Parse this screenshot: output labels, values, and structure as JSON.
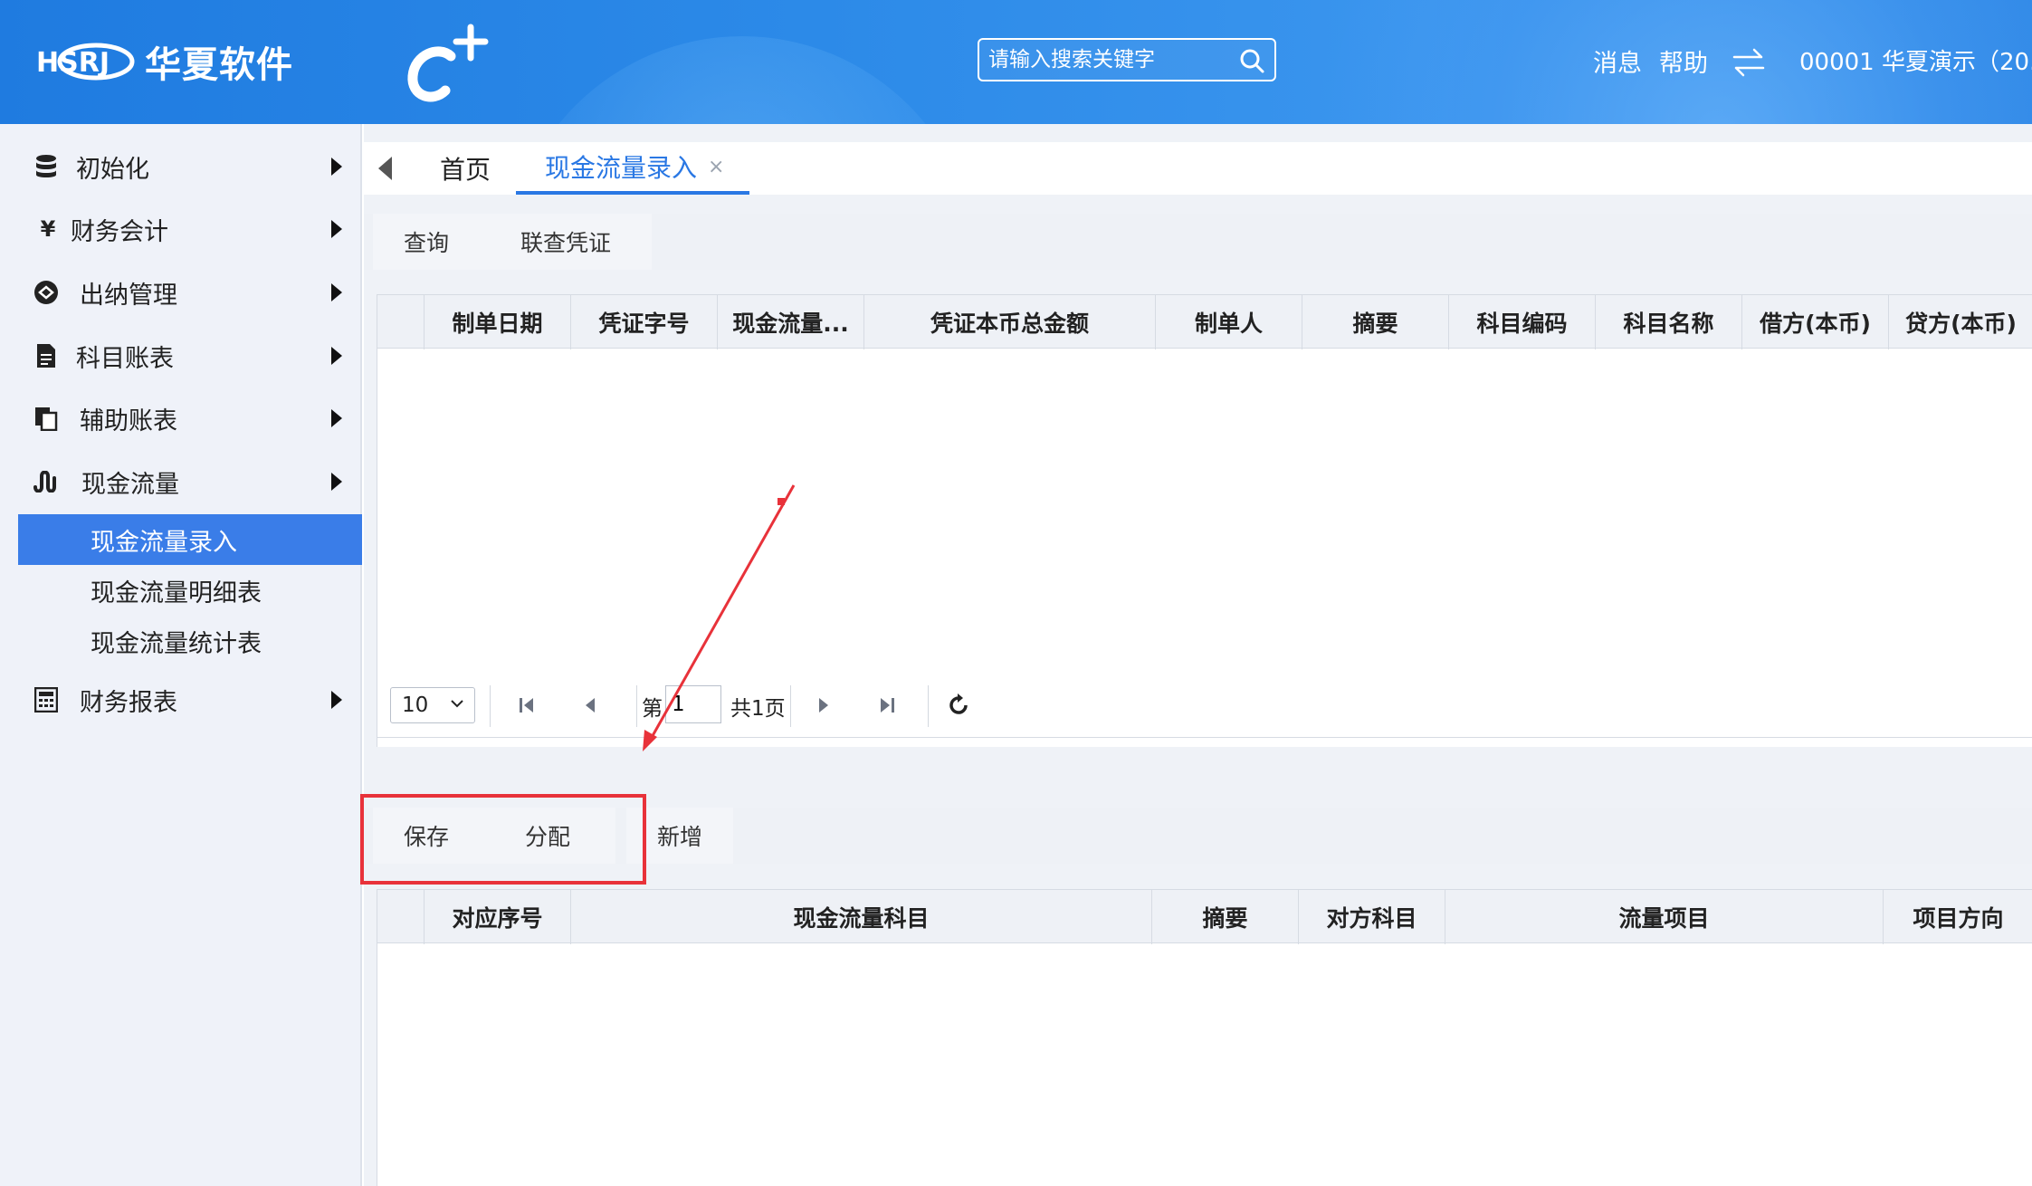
{
  "header": {
    "logo_text": "华夏软件",
    "logo_mark_text": "HSRJ",
    "search_placeholder": "请输入搜索关键字",
    "links": {
      "message": "消息",
      "help": "帮助"
    },
    "user": "00001 华夏演示（20..."
  },
  "sidebar": {
    "items": [
      {
        "label": "初始化",
        "icon": "database-icon"
      },
      {
        "label": "财务会计",
        "icon": "yen-icon"
      },
      {
        "label": "出纳管理",
        "icon": "cashier-icon"
      },
      {
        "label": "科目账表",
        "icon": "document-icon"
      },
      {
        "label": "辅助账表",
        "icon": "copy-document-icon"
      },
      {
        "label": "现金流量",
        "icon": "cash-flow-icon"
      },
      {
        "label": "财务报表",
        "icon": "calculator-icon"
      }
    ],
    "sub_items": [
      {
        "label": "现金流量录入",
        "active": true
      },
      {
        "label": "现金流量明细表"
      },
      {
        "label": "现金流量统计表"
      }
    ]
  },
  "tabs": {
    "home": "首页",
    "active": "现金流量录入",
    "close": "×"
  },
  "toolbar_top": {
    "query": "查询",
    "linked_voucher": "联查凭证"
  },
  "grid_top": {
    "columns": [
      "制单日期",
      "凭证字号",
      "现金流量...",
      "凭证本币总金额",
      "制单人",
      "摘要",
      "科目编码",
      "科目名称",
      "借方(本币)",
      "贷方(本币)"
    ]
  },
  "pager": {
    "page_size": "10",
    "page_prefix": "第",
    "page_value": "1",
    "total": "共1页"
  },
  "toolbar_bottom": {
    "save": "保存",
    "allocate": "分配",
    "add": "新增"
  },
  "grid_bottom": {
    "columns": [
      "对应序号",
      "现金流量科目",
      "摘要",
      "对方科目",
      "流量项目",
      "项目方向"
    ]
  },
  "colors": {
    "header_blue": "#2c8ae8",
    "active_blue": "#3a7de8",
    "annotation_red": "#e8323a"
  }
}
